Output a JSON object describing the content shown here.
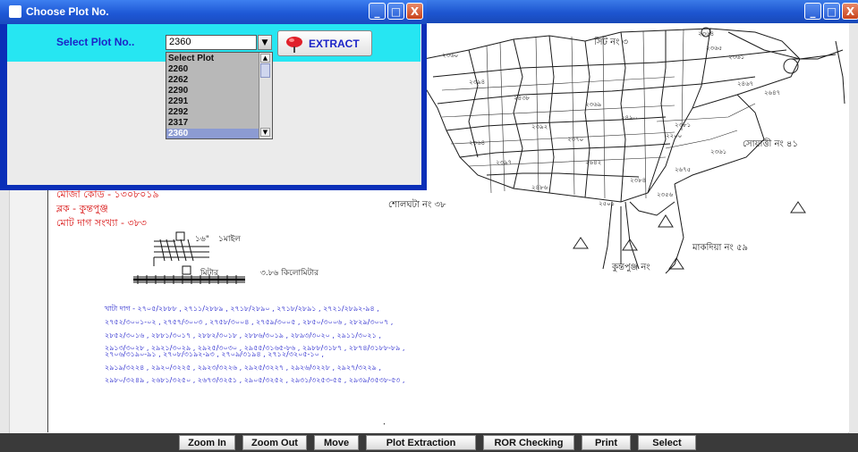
{
  "dialog": {
    "title": "Choose Plot No.",
    "select_label": "Select Plot No..",
    "selected_value": "2360",
    "extract_label": "EXTRACT",
    "options": [
      "Select Plot",
      "2260",
      "2262",
      "2290",
      "2291",
      "2292",
      "2317",
      "2360"
    ],
    "selected_option": "2360",
    "buttons": {
      "minimize": "_",
      "maximize": "□",
      "close": "X"
    }
  },
  "main_window": {
    "buttons": {
      "minimize": "_",
      "maximize": "□",
      "close": "X"
    }
  },
  "map": {
    "left_info": {
      "mouza_code": "মৌজা কোড - ১৩০৮০১৯",
      "block": "ব্লক - কুন্তপুঞ্জ",
      "total_plots": "মোট দাগ সংখ্যা - ৩৮৩"
    },
    "labels": {
      "top_ward": "সিট নং ৩",
      "right_ward": "সোয়াত্তী নং ৪১",
      "bottom_ward": "শোলঘটা নং ৩৮",
      "markdia": "মাকদিয়া নং ৫৯",
      "kundapunj": "কুন্তপুঞ্জ নং"
    },
    "scale": {
      "inch_label": "১৬\"",
      "mile_label": "১মাইল",
      "meter_label": "মিটার",
      "km_label": "৩.৮৬ কিলোমিটার"
    },
    "plot_list_lines": [
      "খাটা দাগ - ২৭০৫/২৮৮৮ , ২৭১১/২৮৮৯ , ২৭১৮/২৮৯০ , ২৭১৮/২৮৯১ , ২৭২১/২৮৯২-৯৪ ,",
      "২৭৫২/৩০০১-০২ , ২৭৫৭/৩০০৩ , ২৭৫৮/৩০০৪ , ২৭৫৯/৩০০৫ , ২৮৫০/৩০০৬ , ২৮২৯/৩০০৭ ,",
      "২৮৫২/৩০১৬ , ২৮৮১/৩০১৭ , ২৮৮২/৩০১৮ , ২৮৮৬/৩০১৯ , ২৮৯৩/৩০২০ , ২৯১১/৩০২১ ,",
      "২৯১৩/৩০২৮ , ২৯২১/৩০২৯ , ২৯২৫/৩০৩০ , ২৯৫৫/৩১৬৫-৮৬ , ২৯৮৮/৩১৮৭ , ২৮৭৪/৩১৮৮-৮৯ ,",
      "২৯১৯/৩২২৪ , ২৯২০/৩২২৫ , ২৯২৩/৩২২৬ , ২৯২৫/৩২২৭ , ২৯২৬/৩২২৮ , ২৯২৭/৩২২৯ ,",
      "২৯৮০/৩২৪৯ , ২৬৮১/৩২৫০ , ২৬৭৩/৩২৫১ , ২৯০৫/৩২৫২ , ২৯৩১/৩২৫৩-৫৫ , ২৯৩৯/৩৫৩৮-৫৩ ,"
    ],
    "overlap_line": "২৭০৬/৩১৯০-৯১ , ২৭০৮/৩১৯২-৯৩ , ২৭০৯/৩১৯৪ , ২৭১২/৩২০৫-১০ ,",
    "plot_numbers": [
      "২৩৬৪",
      "২৩৬০",
      "২৩৬৫",
      "২৩৬১",
      "২৪৩৮",
      "২৩৯৪",
      "২৩৬৯",
      "২৪৯০",
      "২৪৬৭",
      "২৩৮১",
      "২৩৯২",
      "২২০০",
      "২৩৭০",
      "২৩৬৪",
      "২৩৯৭",
      "২৬৪২",
      "২৬৭৫",
      "২৩৮৪",
      "২৪৮৬",
      "২৩৬১",
      "২৩৫৬",
      "২৬৪৭",
      "২৫০১"
    ]
  },
  "toolbar": {
    "zoom_in": "Zoom In",
    "zoom_out": "Zoom Out",
    "move": "Move",
    "plot_extraction": "Plot Extraction",
    "ror_checking": "ROR Checking",
    "print": "Print",
    "select": "Select"
  },
  "colors": {
    "title_bar": "#1d55d0",
    "dialog_panel": "#26e6f2",
    "label_blue": "#1c24c8",
    "map_red": "#d81010",
    "map_blue": "#2222cc"
  }
}
